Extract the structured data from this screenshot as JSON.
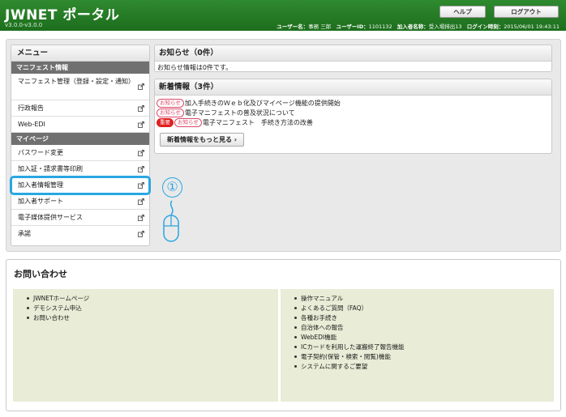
{
  "header": {
    "title": "JWNET ポータル",
    "version": "v3.0.0-v3.0.0",
    "user_name_label": "ユーザー名：",
    "user_name": "事務 三郎",
    "user_id_label": "ユーザーID：",
    "user_id": "1101132",
    "member_name_label": "加入者名称：",
    "member_name": "受入場排出13",
    "login_time_label": "ログイン時刻：",
    "login_time": "2015/06/01 19:43:11",
    "help_label": "ヘルプ",
    "logout_label": "ログアウト"
  },
  "sidebar": {
    "title": "メニュー",
    "sections": [
      {
        "header": "マニフェスト情報",
        "items": [
          {
            "label": "マニフェスト管理（登録・設定・通知）"
          },
          {
            "label": "行政報告"
          },
          {
            "label": "Web-EDI"
          }
        ]
      },
      {
        "header": "マイページ",
        "items": [
          {
            "label": "パスワード変更"
          },
          {
            "label": "加入証・請求書等印刷"
          },
          {
            "label": "加入者情報管理"
          },
          {
            "label": "加入者サポート"
          },
          {
            "label": "電子媒体提供サービス"
          },
          {
            "label": "承諾"
          }
        ]
      }
    ]
  },
  "notices": {
    "title": "お知らせ（0件）",
    "body": "お知らせ情報は0件です。"
  },
  "news": {
    "title": "新着情報（3件）",
    "items": [
      {
        "important": "",
        "tag": "お知らせ",
        "text": "加入手続きのＷｅｂ化及びマイページ機能の提供開始"
      },
      {
        "important": "",
        "tag": "お知らせ",
        "text": "電子マニフェストの普及状況について"
      },
      {
        "important": "重要",
        "tag": "お知らせ",
        "text": "電子マニフェスト　手続き方法の改善"
      }
    ],
    "more_label": "新着情報をもっと見る ›"
  },
  "annotation": {
    "step": "①"
  },
  "contact": {
    "title": "お問い合わせ",
    "left_links": [
      "JWNETホームページ",
      "デモシステム申込",
      "お問い合わせ"
    ],
    "right_links": [
      "操作マニュアル",
      "よくあるご質問（FAQ）",
      "各種お手続き",
      "自治体への報告",
      "WebEDI機能",
      "ICカードを利用した運搬終了報告機能",
      "電子契約(保管・検索・閲覧)機能",
      "システムに関するご要望"
    ]
  },
  "colors": {
    "header_green": "#1d6e1d",
    "highlight_blue": "#2aa6e3",
    "important_red": "#e02020",
    "tag_pink": "#d94a6a",
    "contact_bg": "#e9ecd6"
  }
}
